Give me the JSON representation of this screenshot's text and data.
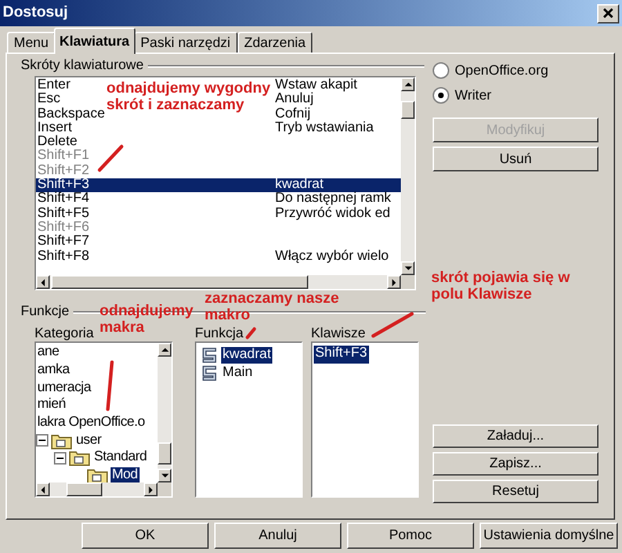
{
  "window": {
    "title": "Dostosuj"
  },
  "tabs": [
    {
      "label": "Menu",
      "selected": false
    },
    {
      "label": "Klawiatura",
      "selected": true
    },
    {
      "label": "Paski narzędzi",
      "selected": false
    },
    {
      "label": "Zdarzenia",
      "selected": false
    }
  ],
  "shortcuts": {
    "label": "Skróty klawiaturowe",
    "rows": [
      {
        "key": "Enter",
        "command": "Wstaw akapit",
        "disabled": false,
        "selected": false
      },
      {
        "key": "Esc",
        "command": "Anuluj",
        "disabled": false,
        "selected": false
      },
      {
        "key": "Backspace",
        "command": "Cofnij",
        "disabled": false,
        "selected": false
      },
      {
        "key": "Insert",
        "command": "Tryb wstawiania",
        "disabled": false,
        "selected": false
      },
      {
        "key": "Delete",
        "disabled": false,
        "selected": false
      },
      {
        "key": "Shift+F1",
        "disabled": true,
        "selected": false
      },
      {
        "key": "Shift+F2",
        "disabled": true,
        "selected": false
      },
      {
        "key": "Shift+F3",
        "command": "kwadrat",
        "disabled": false,
        "selected": true
      },
      {
        "key": "Shift+F4",
        "command": "Do następnej ramk",
        "disabled": false,
        "selected": false
      },
      {
        "key": "Shift+F5",
        "command": "Przywróć widok ed",
        "disabled": false,
        "selected": false
      },
      {
        "key": "Shift+F6",
        "disabled": true,
        "selected": false
      },
      {
        "key": "Shift+F7",
        "disabled": false,
        "selected": false
      },
      {
        "key": "Shift+F8",
        "command": "Włącz wybór wielo",
        "disabled": false,
        "selected": false
      }
    ]
  },
  "scope": [
    {
      "label": "OpenOffice.org",
      "selected": false
    },
    {
      "label": "Writer",
      "selected": true
    }
  ],
  "side_buttons": [
    {
      "label": "Modyfikuj",
      "disabled": true
    },
    {
      "label": "Usuń",
      "disabled": false
    }
  ],
  "functions": {
    "label": "Funkcje",
    "category": {
      "label": "Kategoria",
      "items": [
        {
          "label": "ane",
          "kind": "plain",
          "selected": false
        },
        {
          "label": "amka",
          "kind": "plain",
          "selected": false
        },
        {
          "label": "umeracja",
          "kind": "plain",
          "selected": false
        },
        {
          "label": "mień",
          "kind": "plain",
          "selected": false
        },
        {
          "label": "lakra OpenOffice.o",
          "kind": "plain",
          "selected": false,
          "children": [
            {
              "label": "user",
              "kind": "folder",
              "selected": false,
              "expanded": true,
              "children": [
                {
                  "label": "Standard",
                  "kind": "folder",
                  "selected": false,
                  "expanded": true,
                  "children": [
                    {
                      "label": "Mod",
                      "kind": "folder",
                      "selected": true
                    }
                  ]
                }
              ]
            }
          ]
        }
      ]
    },
    "function": {
      "label": "Funkcja",
      "items": [
        {
          "label": "kwadrat",
          "selected": true
        },
        {
          "label": "Main",
          "selected": false
        }
      ]
    },
    "keys": {
      "label": "Klawisze",
      "items": [
        {
          "label": "Shift+F3",
          "selected": true
        }
      ]
    }
  },
  "file_buttons": [
    "Załaduj...",
    "Zapisz...",
    "Resetuj"
  ],
  "footer_buttons": [
    "OK",
    "Anuluj",
    "Pomoc",
    "Ustawienia domyślne"
  ],
  "annotations": [
    {
      "text": "odnajdujemy wygodny skrót i zaznaczamy"
    },
    {
      "text": "odnajdujemy makra"
    },
    {
      "text": "zaznaczamy nasze makro"
    },
    {
      "text": "skrót pojawia się w polu Klawisze"
    }
  ]
}
